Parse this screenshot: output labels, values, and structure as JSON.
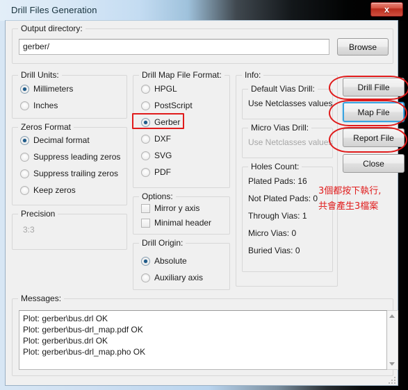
{
  "window": {
    "title": "Drill Files Generation",
    "close_label": "x"
  },
  "output_directory": {
    "group_label": "Output directory:",
    "value": "gerber/",
    "browse_label": "Browse"
  },
  "drill_units": {
    "group_label": "Drill Units:",
    "options": [
      {
        "label": "Millimeters",
        "selected": true
      },
      {
        "label": "Inches",
        "selected": false
      }
    ]
  },
  "zeros_format": {
    "group_label": "Zeros Format",
    "options": [
      {
        "label": "Decimal format",
        "selected": true
      },
      {
        "label": "Suppress leading zeros",
        "selected": false
      },
      {
        "label": "Suppress trailing zeros",
        "selected": false
      },
      {
        "label": "Keep zeros",
        "selected": false
      }
    ]
  },
  "precision": {
    "group_label": "Precision",
    "value": "3:3"
  },
  "drill_map_file_format": {
    "group_label": "Drill Map File Format:",
    "options": [
      {
        "label": "HPGL",
        "selected": false
      },
      {
        "label": "PostScript",
        "selected": false
      },
      {
        "label": "Gerber",
        "selected": true
      },
      {
        "label": "DXF",
        "selected": false
      },
      {
        "label": "SVG",
        "selected": false
      },
      {
        "label": "PDF",
        "selected": false
      }
    ]
  },
  "options": {
    "group_label": "Options:",
    "items": [
      {
        "label": "Mirror y axis",
        "checked": false
      },
      {
        "label": "Minimal header",
        "checked": false
      }
    ]
  },
  "drill_origin": {
    "group_label": "Drill Origin:",
    "options": [
      {
        "label": "Absolute",
        "selected": true
      },
      {
        "label": "Auxiliary axis",
        "selected": false
      }
    ]
  },
  "info": {
    "group_label": "Info:",
    "default_vias_drill": {
      "group_label": "Default Vias Drill:",
      "value": "Use Netclasses values"
    },
    "micro_vias_drill": {
      "group_label": "Micro Vias Drill:",
      "value": "Use Netclasses values",
      "disabled": true
    },
    "holes_count": {
      "group_label": "Holes Count:",
      "rows": [
        "Plated Pads: 16",
        "Not Plated Pads: 0",
        "Through Vias: 1",
        "Micro Vias: 0",
        "Buried Vias: 0"
      ]
    }
  },
  "buttons": [
    {
      "label": "Drill Fille",
      "focused": false
    },
    {
      "label": "Map File",
      "focused": true
    },
    {
      "label": "Report File",
      "focused": false
    },
    {
      "label": "Close",
      "focused": false
    }
  ],
  "messages": {
    "group_label": "Messages:",
    "lines": [
      "Plot: gerber\\bus.drl OK",
      "Plot: gerber\\bus-drl_map.pdf OK",
      "Plot: gerber\\bus.drl OK",
      "Plot: gerber\\bus-drl_map.pho OK"
    ]
  },
  "annotation": {
    "color": "#e01b1b",
    "note_line1": "3個都按下執行,",
    "note_line2": "共會產生3檔案"
  }
}
